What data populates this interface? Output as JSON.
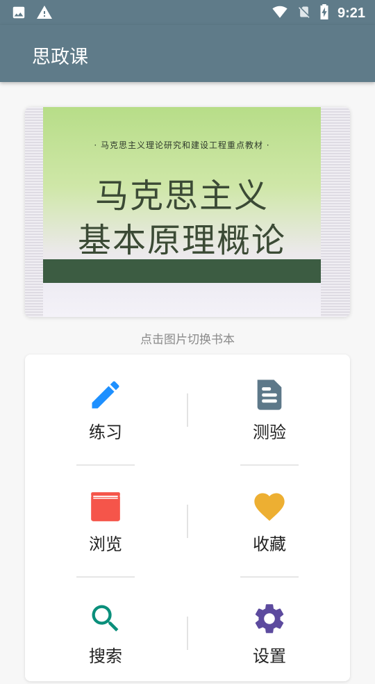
{
  "status_bar": {
    "time": "9:21",
    "icons": [
      "image-icon",
      "warning-icon",
      "wifi-icon",
      "no-sim-icon",
      "battery-charging-icon"
    ]
  },
  "app_bar": {
    "title": "思政课"
  },
  "book_cover": {
    "series": "· 马克思主义理论研究和建设工程重点教材 ·",
    "title_line1": "马克思主义",
    "title_line2": "基本原理概论"
  },
  "hint": "点击图片切换书本",
  "menu": [
    {
      "label": "练习",
      "icon": "pencil-icon",
      "color": "#1e90ff"
    },
    {
      "label": "测验",
      "icon": "document-icon",
      "color": "#5d7889"
    },
    {
      "label": "浏览",
      "icon": "book-icon",
      "color": "#f5554a"
    },
    {
      "label": "收藏",
      "icon": "heart-icon",
      "color": "#edaf32"
    },
    {
      "label": "搜索",
      "icon": "search-icon",
      "color": "#0a8f7b"
    },
    {
      "label": "设置",
      "icon": "gear-icon",
      "color": "#5c4a9e"
    }
  ]
}
